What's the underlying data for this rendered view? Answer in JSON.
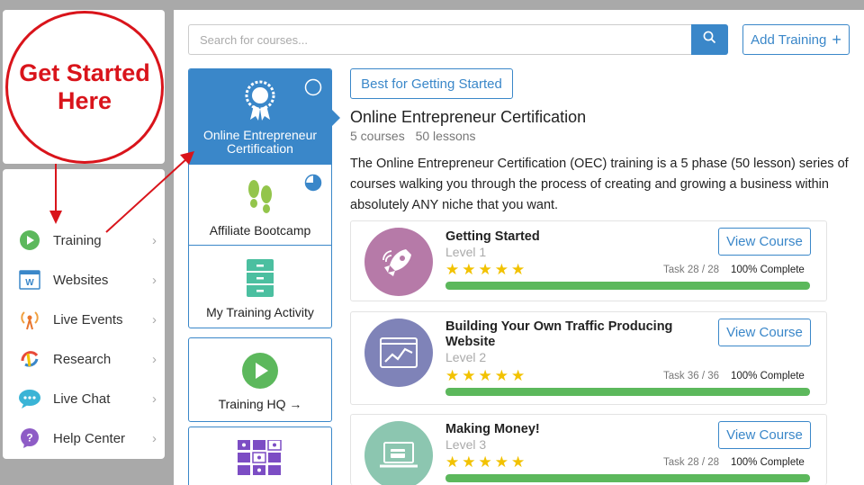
{
  "callout": {
    "line1": "Get Started",
    "line2": "Here"
  },
  "sidebar": {
    "items": [
      {
        "label": "Training",
        "icon": "play-circle-icon"
      },
      {
        "label": "Websites",
        "icon": "website-icon"
      },
      {
        "label": "Live Events",
        "icon": "broadcast-icon"
      },
      {
        "label": "Research",
        "icon": "research-icon"
      },
      {
        "label": "Live Chat",
        "icon": "chat-icon"
      },
      {
        "label": "Help Center",
        "icon": "help-icon"
      }
    ],
    "chevron": "›"
  },
  "search": {
    "placeholder": "Search for courses..."
  },
  "toolbar": {
    "add_label": "Add Training",
    "add_symbol": "+"
  },
  "training_cards": [
    {
      "label": "Online Entrepreneur Certification",
      "icon": "award-ribbon-icon",
      "active": true
    },
    {
      "label": "Affiliate Bootcamp",
      "icon": "footprints-icon"
    },
    {
      "label": "My Training Activity",
      "icon": "cabinet-icon"
    },
    {
      "label": "Training HQ →",
      "icon": "play-circle-icon"
    }
  ],
  "main": {
    "badge_label": "Best for Getting Started",
    "title": "Online Entrepreneur Certification",
    "courses_count": "5 courses",
    "lessons_count": "50 lessons",
    "description": "The Online Entrepreneur Certification (OEC) training is a 5 phase (50 lesson) series of courses walking you through the process of creating and growing a business within absolutely ANY niche that you want."
  },
  "courses": [
    {
      "title": "Getting Started",
      "level": "Level 1",
      "stars": "★★★★★",
      "task": "Task 28 / 28",
      "complete": "100% Complete",
      "progress": 1.0,
      "view_label": "View Course",
      "thumb_color": "#b67aa8"
    },
    {
      "title": "Building Your Own Traffic Producing Website",
      "level": "Level 2",
      "stars": "★★★★★",
      "task": "Task 36 / 36",
      "complete": "100% Complete",
      "progress": 1.0,
      "view_label": "View Course",
      "thumb_color": "#7f83b8"
    },
    {
      "title": "Making Money!",
      "level": "Level 3",
      "stars": "★★★★★",
      "task": "Task 28 / 28",
      "complete": "100% Complete",
      "progress": 1.0,
      "view_label": "View Course",
      "thumb_color": "#8cc6b0"
    }
  ],
  "colors": {
    "accent": "#3a87c9",
    "progress": "#5cb85c",
    "callout": "#d9141b",
    "stars": "#f2c200"
  }
}
